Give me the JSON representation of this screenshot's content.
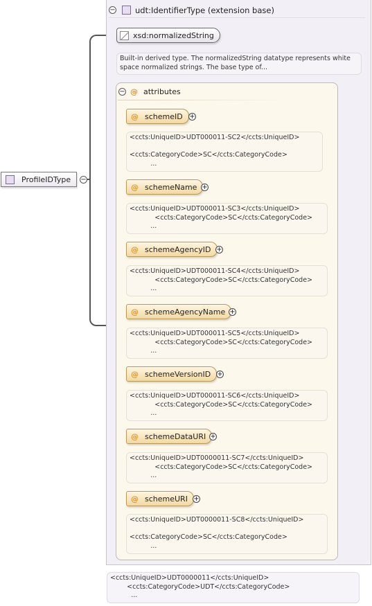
{
  "profile": {
    "name": "ProfileIDType"
  },
  "extension": {
    "title": "udt:IdentifierType (extension base)"
  },
  "base_type": {
    "name": "xsd:normalizedString",
    "description": [
      "Built-in derived type. The normalizedString datatype represents white",
      "space normalized strings. The base type of..."
    ]
  },
  "attributes": {
    "title": "attributes",
    "items": [
      {
        "name": "schemeID",
        "doc": [
          "<ccts:UniqueID>UDT000011-SC2</ccts:UniqueID>",
          "",
          "<ccts:CategoryCode>SC</ccts:CategoryCode>",
          "          ..."
        ]
      },
      {
        "name": "schemeName",
        "doc": [
          "<ccts:UniqueID>UDT000011-SC3</ccts:UniqueID>",
          "            <ccts:CategoryCode>SC</ccts:CategoryCode>",
          "          ..."
        ]
      },
      {
        "name": "schemeAgencyID",
        "doc": [
          "<ccts:UniqueID>UDT000011-SC4</ccts:UniqueID>",
          "            <ccts:CategoryCode>SC</ccts:CategoryCode>",
          "          ..."
        ]
      },
      {
        "name": "schemeAgencyName",
        "doc": [
          "<ccts:UniqueID>UDT000011-SC5</ccts:UniqueID>",
          "            <ccts:CategoryCode>SC</ccts:CategoryCode>",
          "          ..."
        ]
      },
      {
        "name": "schemeVersionID",
        "doc": [
          "<ccts:UniqueID>UDT000011-SC6</ccts:UniqueID>",
          "            <ccts:CategoryCode>SC</ccts:CategoryCode>",
          "          ..."
        ]
      },
      {
        "name": "schemeDataURI",
        "doc": [
          "<ccts:UniqueID>UDT0000011-SC7</ccts:UniqueID>",
          "            <ccts:CategoryCode>SC</ccts:CategoryCode>",
          "          ..."
        ]
      },
      {
        "name": "schemeURI",
        "doc": [
          "<ccts:UniqueID>UDT0000011-SC8</ccts:UniqueID>",
          "",
          "<ccts:CategoryCode>SC</ccts:CategoryCode>",
          "          ..."
        ]
      }
    ]
  },
  "footer_doc": [
    "<ccts:UniqueID>UDT0000011</ccts:UniqueID>",
    "        <ccts:CategoryCode>UDT</ccts:CategoryCode>",
    "          ..."
  ],
  "symbols": {
    "collapse": "−",
    "expand": "+",
    "attribute": "@"
  },
  "colors": {
    "attribute_accent": "#e0962a",
    "type_icon": "#e8ddf3",
    "attr_fill": "#f2d9a3"
  }
}
